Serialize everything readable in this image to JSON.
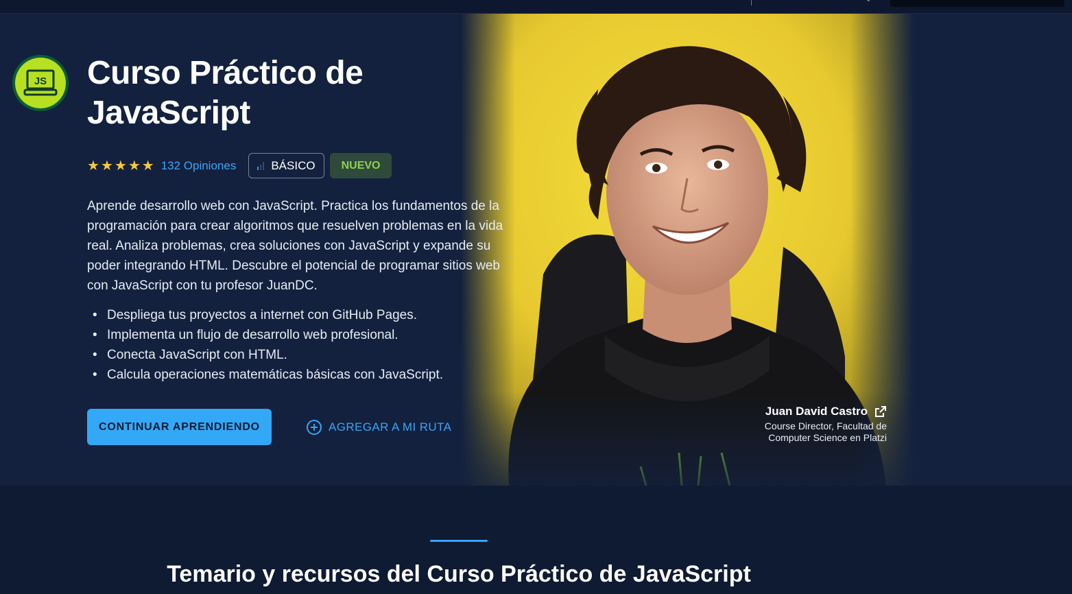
{
  "course": {
    "title": "Curso Práctico de JavaScript",
    "badge_text": "JS",
    "rating_stars": 5,
    "reviews": "132 Opiniones",
    "level": "BÁSICO",
    "tag": "NUEVO",
    "description": "Aprende desarrollo web con JavaScript. Practica los fundamentos de la programación para crear algoritmos que resuelven problemas en la vida real. Analiza problemas, crea soluciones con JavaScript y expande su poder integrando HTML. Descubre el potencial de programar sitios web con JavaScript con tu profesor JuanDC.",
    "bullets": [
      "Despliega tus proyectos a internet con GitHub Pages.",
      "Implementa un flujo de desarrollo web profesional.",
      "Conecta JavaScript con HTML.",
      "Calcula operaciones matemáticas básicas con JavaScript."
    ],
    "primary_button": "CONTINUAR APRENDIENDO",
    "secondary_button": "AGREGAR A MI RUTA"
  },
  "teacher": {
    "name": "Juan David Castro",
    "role": "Course Director, Facultad de Computer Science en Platzi"
  },
  "section": {
    "title": "Temario y recursos del Curso Práctico de JavaScript"
  },
  "colors": {
    "accent": "#33a8f6",
    "star": "#f6c93a",
    "new_tag": "#8fd14f",
    "background": "#13213e"
  }
}
